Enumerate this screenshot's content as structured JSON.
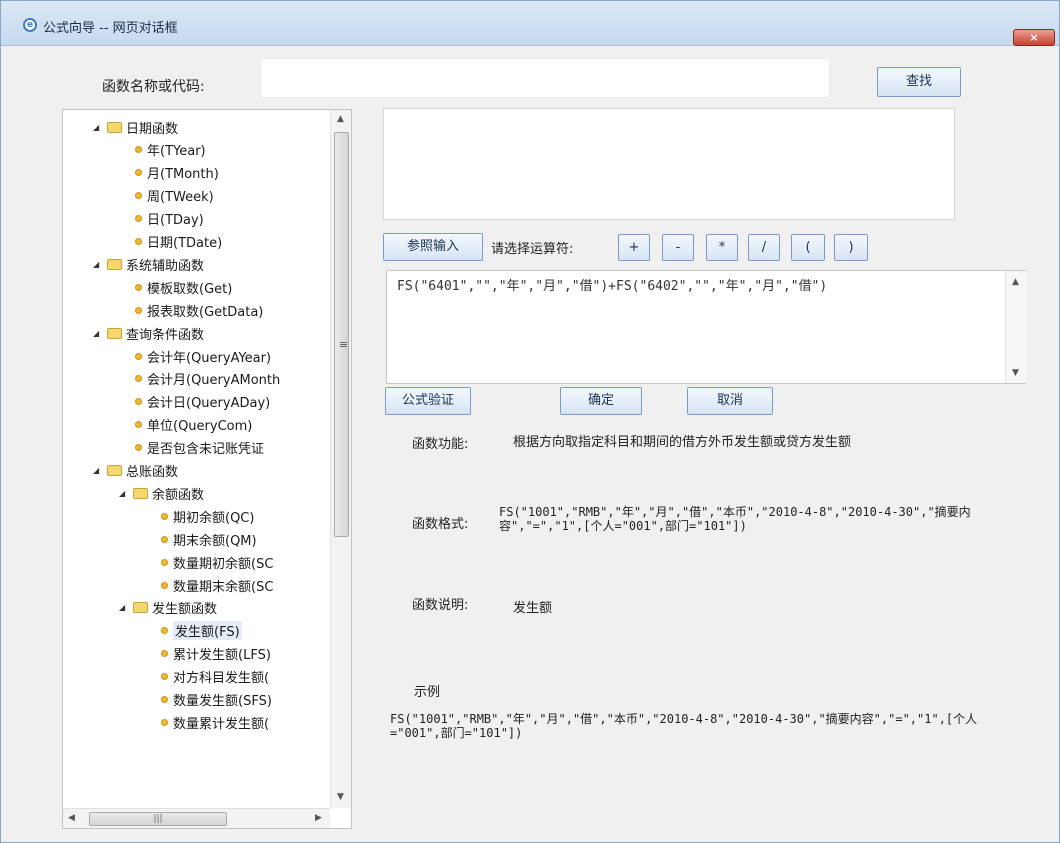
{
  "window": {
    "title": "公式向导 -- 网页对话框",
    "close_label": "×"
  },
  "search": {
    "label": "函数名称或代码:",
    "value": "",
    "button_label": "查找"
  },
  "tree": {
    "items": [
      {
        "level": 0,
        "type": "folder",
        "label": "日期函数",
        "expanded": true
      },
      {
        "level": 1,
        "type": "leaf",
        "label": "年(TYear)"
      },
      {
        "level": 1,
        "type": "leaf",
        "label": "月(TMonth)"
      },
      {
        "level": 1,
        "type": "leaf",
        "label": "周(TWeek)"
      },
      {
        "level": 1,
        "type": "leaf",
        "label": "日(TDay)"
      },
      {
        "level": 1,
        "type": "leaf",
        "label": "日期(TDate)"
      },
      {
        "level": 0,
        "type": "folder",
        "label": "系统辅助函数",
        "expanded": true
      },
      {
        "level": 1,
        "type": "leaf",
        "label": "模板取数(Get)"
      },
      {
        "level": 1,
        "type": "leaf",
        "label": "报表取数(GetData)"
      },
      {
        "level": 0,
        "type": "folder",
        "label": "查询条件函数",
        "expanded": true
      },
      {
        "level": 1,
        "type": "leaf",
        "label": "会计年(QueryAYear)"
      },
      {
        "level": 1,
        "type": "leaf",
        "label": "会计月(QueryAMonth"
      },
      {
        "level": 1,
        "type": "leaf",
        "label": "会计日(QueryADay)"
      },
      {
        "level": 1,
        "type": "leaf",
        "label": "单位(QueryCom)"
      },
      {
        "level": 1,
        "type": "leaf",
        "label": "是否包含未记账凭证"
      },
      {
        "level": 0,
        "type": "folder",
        "label": "总账函数",
        "expanded": true
      },
      {
        "level": 1,
        "type": "folder",
        "label": "余额函数",
        "expanded": true
      },
      {
        "level": 2,
        "type": "leaf",
        "label": "期初余额(QC)"
      },
      {
        "level": 2,
        "type": "leaf",
        "label": "期末余额(QM)"
      },
      {
        "level": 2,
        "type": "leaf",
        "label": "数量期初余额(SC"
      },
      {
        "level": 2,
        "type": "leaf",
        "label": "数量期末余额(SC"
      },
      {
        "level": 1,
        "type": "folder",
        "label": "发生额函数",
        "expanded": true
      },
      {
        "level": 2,
        "type": "leaf",
        "label": "发生额(FS)",
        "selected": true
      },
      {
        "level": 2,
        "type": "leaf",
        "label": "累计发生额(LFS)"
      },
      {
        "level": 2,
        "type": "leaf",
        "label": "对方科目发生额("
      },
      {
        "level": 2,
        "type": "leaf",
        "label": "数量发生额(SFS)"
      },
      {
        "level": 2,
        "type": "leaf",
        "label": "数量累计发生额("
      }
    ]
  },
  "operators": {
    "ref_button": "参照输入",
    "prompt": "请选择运算符:",
    "buttons": [
      "+",
      "-",
      "*",
      "/",
      "(",
      ")"
    ]
  },
  "formula": {
    "value": "FS(\"6401\",\"\",\"年\",\"月\",\"借\")+FS(\"6402\",\"\",\"年\",\"月\",\"借\")"
  },
  "actions": {
    "verify": "公式验证",
    "ok": "确定",
    "cancel": "取消"
  },
  "info": {
    "function_label": "函数功能:",
    "function_value": "根据方向取指定科目和期间的借方外币发生额或贷方发生额",
    "format_label": "函数格式:",
    "format_value": "FS(\"1001\",\"RMB\",\"年\",\"月\",\"借\",\"本币\",\"2010-4-8\",\"2010-4-30\",\"摘要内容\",\"=\",\"1\",[个人=\"001\",部门=\"101\"])",
    "desc_label": "函数说明:",
    "desc_value": "发生额",
    "example_label": "示例",
    "example_value": "FS(\"1001\",\"RMB\",\"年\",\"月\",\"借\",\"本币\",\"2010-4-8\",\"2010-4-30\",\"摘要内容\",\"=\",\"1\",[个人=\"001\",部门=\"101\"])"
  }
}
